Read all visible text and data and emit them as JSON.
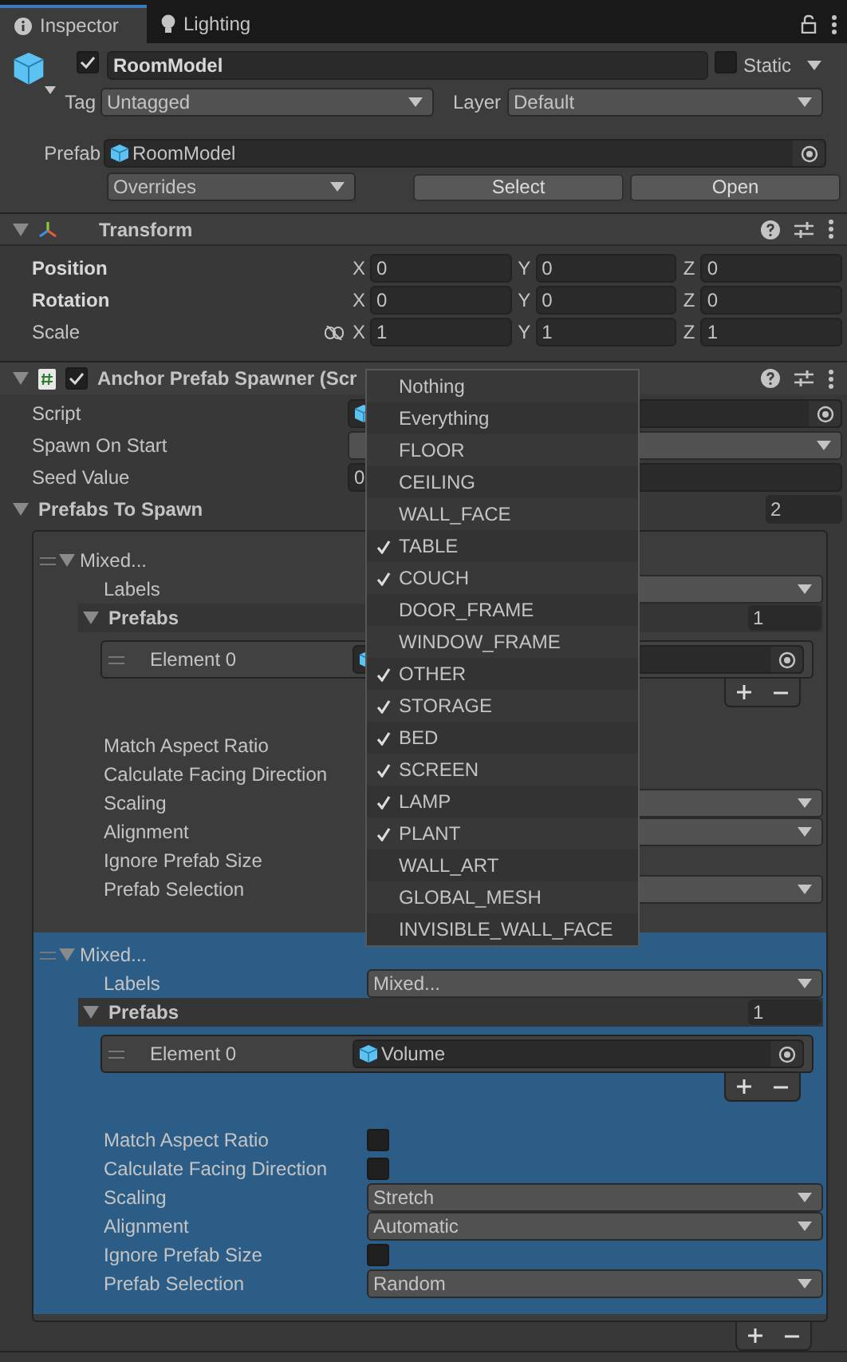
{
  "tabs": [
    {
      "label": "Inspector",
      "selected": true
    },
    {
      "label": "Lighting",
      "selected": false
    }
  ],
  "object": {
    "active": true,
    "name": "RoomModel",
    "static": false,
    "static_label": "Static",
    "tag_label": "Tag",
    "tag": "Untagged",
    "layer_label": "Layer",
    "layer": "Default",
    "prefab_label": "Prefab",
    "prefab": "RoomModel",
    "overrides": "Overrides",
    "buttons": [
      "Select",
      "Open"
    ]
  },
  "transform": {
    "title": "Transform",
    "expanded": true,
    "rows": [
      {
        "label": "Position",
        "overridden": true,
        "link_icon": false,
        "values": [
          {
            "axis": "X",
            "value": "0"
          },
          {
            "axis": "Y",
            "value": "0"
          },
          {
            "axis": "Z",
            "value": "0"
          }
        ]
      },
      {
        "label": "Rotation",
        "overridden": true,
        "link_icon": false,
        "values": [
          {
            "axis": "X",
            "value": "0"
          },
          {
            "axis": "Y",
            "value": "0"
          },
          {
            "axis": "Z",
            "value": "0"
          }
        ]
      },
      {
        "label": "Scale",
        "overridden": false,
        "link_icon": true,
        "values": [
          {
            "axis": "X",
            "value": "1"
          },
          {
            "axis": "Y",
            "value": "1"
          },
          {
            "axis": "Z",
            "value": "1"
          }
        ]
      }
    ]
  },
  "spawner": {
    "title": "Anchor Prefab Spawner (Scr",
    "enabled": true,
    "expanded": true,
    "fields": [
      {
        "label": "Script",
        "kind": "object"
      },
      {
        "label": "Spawn On Start",
        "kind": "dropdown"
      },
      {
        "label": "Seed Value",
        "kind": "text",
        "value": "0"
      }
    ],
    "list": {
      "label": "Prefabs To Spawn",
      "count": "2",
      "expanded": true,
      "elements": [
        {
          "title": "Mixed...",
          "selected": false,
          "expanded": true,
          "labels_label": "Labels",
          "prefabs": {
            "label": "Prefabs",
            "count": "1",
            "expanded": true,
            "items": [
              {
                "label": "Element 0"
              }
            ]
          },
          "props": [
            {
              "label": "Match Aspect Ratio",
              "kind": "checkbox"
            },
            {
              "label": "Calculate Facing Direction",
              "kind": "checkbox"
            },
            {
              "label": "Scaling",
              "kind": "dropdown"
            },
            {
              "label": "Alignment",
              "kind": "dropdown"
            },
            {
              "label": "Ignore Prefab Size",
              "kind": "checkbox"
            },
            {
              "label": "Prefab Selection",
              "kind": "dropdown"
            }
          ]
        },
        {
          "title": "Mixed...",
          "selected": true,
          "expanded": true,
          "labels_label": "Labels",
          "labels_value": "Mixed...",
          "prefabs": {
            "label": "Prefabs",
            "count": "1",
            "expanded": true,
            "items": [
              {
                "label": "Element 0",
                "value": "Volume"
              }
            ]
          },
          "props": [
            {
              "label": "Match Aspect Ratio",
              "kind": "checkbox",
              "checked": false
            },
            {
              "label": "Calculate Facing Direction",
              "kind": "checkbox",
              "checked": false
            },
            {
              "label": "Scaling",
              "kind": "dropdown",
              "value": "Stretch"
            },
            {
              "label": "Alignment",
              "kind": "dropdown",
              "value": "Automatic"
            },
            {
              "label": "Ignore Prefab Size",
              "kind": "checkbox",
              "checked": false
            },
            {
              "label": "Prefab Selection",
              "kind": "dropdown",
              "value": "Random"
            }
          ]
        }
      ]
    }
  },
  "popup": {
    "options": [
      {
        "label": "Nothing",
        "checked": false
      },
      {
        "label": "Everything",
        "checked": false
      },
      {
        "label": "FLOOR",
        "checked": false
      },
      {
        "label": "CEILING",
        "checked": false
      },
      {
        "label": "WALL_FACE",
        "checked": false
      },
      {
        "label": "TABLE",
        "checked": true
      },
      {
        "label": "COUCH",
        "checked": true
      },
      {
        "label": "DOOR_FRAME",
        "checked": false
      },
      {
        "label": "WINDOW_FRAME",
        "checked": false
      },
      {
        "label": "OTHER",
        "checked": true
      },
      {
        "label": "STORAGE",
        "checked": true
      },
      {
        "label": "BED",
        "checked": true
      },
      {
        "label": "SCREEN",
        "checked": true
      },
      {
        "label": "LAMP",
        "checked": true
      },
      {
        "label": "PLANT",
        "checked": true
      },
      {
        "label": "WALL_ART",
        "checked": false
      },
      {
        "label": "GLOBAL_MESH",
        "checked": false
      },
      {
        "label": "INVISIBLE_WALL_FACE",
        "checked": false
      }
    ]
  }
}
